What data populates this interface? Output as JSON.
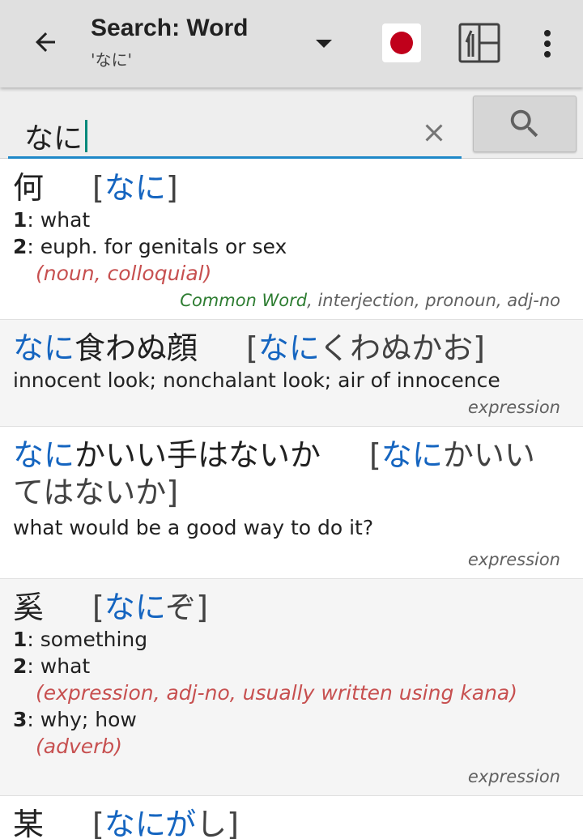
{
  "appbar": {
    "title": "Search: Word",
    "subtitle": "'なに'",
    "back_icon": "arrow-left-icon",
    "dropdown_icon": "caret-down-icon",
    "flag_icon": "japan-flag-icon",
    "kanji_icon": "kanji-layout-icon",
    "menu_icon": "more-vert-icon",
    "flag_color": "#c0001b"
  },
  "search": {
    "value": "なに",
    "clear_icon": "close-icon",
    "search_icon": "magnifier-icon"
  },
  "results": [
    {
      "word": "何",
      "reading_prefix": "[",
      "reading_hl": "なに",
      "reading_rest": "",
      "reading_suffix": "]",
      "senses": [
        {
          "n": "1",
          "text": ": what"
        },
        {
          "n": "2",
          "text": ": euph. for genitals or sex"
        }
      ],
      "sense_pos": "(noun, colloquial)",
      "tag_common": "Common Word",
      "tags": ", interjection, pronoun, adj-no"
    },
    {
      "word_hl": "なに",
      "word_rest": "食わぬ顔",
      "reading_prefix": "[",
      "reading_hl": "なに",
      "reading_rest": "くわぬかお",
      "reading_suffix": "]",
      "gloss": "innocent look; nonchalant look; air of innocence",
      "tags": "expression"
    },
    {
      "word_hl": "なに",
      "word_rest": "かいい手はないか",
      "reading_prefix": "[",
      "reading_hl": "なに",
      "reading_rest_line1": "かいい",
      "reading_rest_line2": "てはないか",
      "reading_suffix": "]",
      "gloss": "what would be a good way to do it?",
      "tags": "expression"
    },
    {
      "word": "奚",
      "reading_prefix": "[",
      "reading_hl": "なに",
      "reading_rest": "ぞ",
      "reading_suffix": "]",
      "s1_n": "1",
      "s1_text": ": something",
      "s2_n": "2",
      "s2_text": ": what",
      "s2_pos": "(expression, adj-no, usually written using kana)",
      "s3_n": "3",
      "s3_text": ": why; how",
      "s3_pos": "(adverb)",
      "tags": "expression"
    },
    {
      "word": "某",
      "reading_prefix": "[",
      "reading_hl": "なにが",
      "reading_rest": "し",
      "reading_suffix": "]"
    }
  ]
}
